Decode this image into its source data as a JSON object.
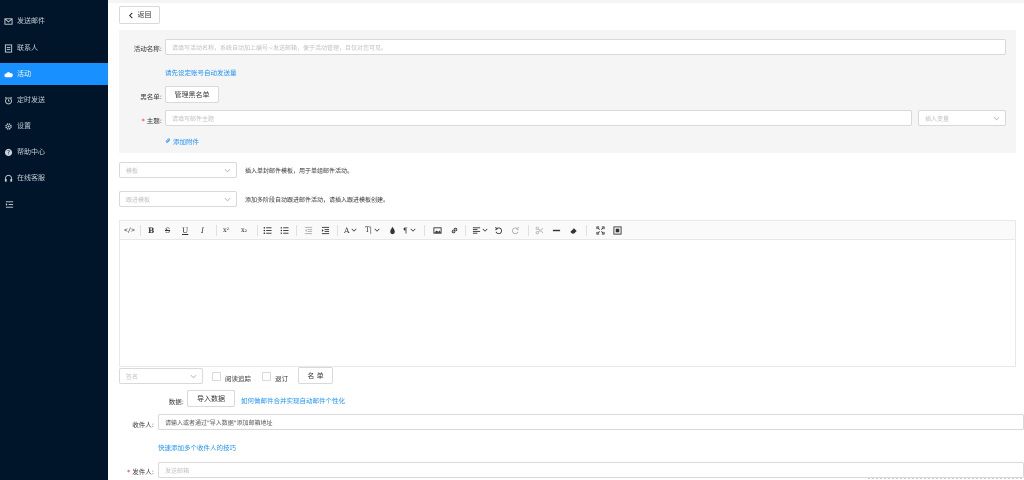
{
  "sidebar": {
    "items": [
      {
        "label": "发送邮件",
        "icon": "mail-icon"
      },
      {
        "label": "联系人",
        "icon": "contacts-icon"
      },
      {
        "label": "活动",
        "icon": "cloud-icon"
      },
      {
        "label": "定时发送",
        "icon": "alarm-clock-icon"
      },
      {
        "label": "设置",
        "icon": "gear-icon"
      },
      {
        "label": "帮助中心",
        "icon": "question-icon"
      },
      {
        "label": "在线客服",
        "icon": "headset-icon"
      }
    ],
    "active_item": "活动",
    "collapse_icon": "menu-fold-icon",
    "colors": {
      "background": "#001529",
      "active": "#1890ff"
    }
  },
  "header": {
    "back_label": "返回"
  },
  "form": {
    "activity_name_label": "活动名称:",
    "activity_name_placeholder": "请填写活动名称，系统自动加上编号~发送邮箱，便于活动管理，且仅对您可见。",
    "set_sender_link": "请先设定账号自动发送量",
    "blacklist_label": "黑名单:",
    "blacklist_button": "管理黑名单",
    "subject_required": "*",
    "subject_label": "主题:",
    "subject_placeholder": "请填写邮件主题",
    "insert_variable_placeholder": "插入变量",
    "add_attachment_link": "添加附件"
  },
  "templates": {
    "template_placeholder": "模板",
    "template_hint": "插入单封邮件模板，用于单组邮件活动。",
    "followup_placeholder": "跟进模板",
    "followup_hint": "添加多阶段自动跟进邮件活动，请插入跟进模板创建。"
  },
  "editor": {
    "toolbar": [
      "code-icon",
      "bold-icon",
      "strikethrough-icon",
      "underline-icon",
      "italic-icon",
      "superscript-icon",
      "subscript-icon",
      "unordered-list-icon",
      "ordered-list-icon",
      "outdent-icon",
      "indent-icon",
      "font-color-icon",
      "font-size-icon",
      "fill-color-icon",
      "paragraph-icon",
      "image-icon",
      "link-icon",
      "align-icon",
      "undo-icon",
      "redo-icon",
      "cut-icon",
      "horizontal-rule-icon",
      "eraser-icon",
      "fullscreen-icon",
      "source-icon"
    ],
    "toolbar_text": {
      "code": "</>",
      "bold": "B",
      "strike": "S",
      "underline": "U",
      "italic": "I",
      "sup": "x²",
      "sub": "x₂",
      "font_color": "A",
      "font_size": "T|",
      "paragraph": "¶"
    }
  },
  "options": {
    "signature_placeholder": "签名",
    "read_tracking_label": "阅读追踪",
    "tracking_label": "退订",
    "list_button": "名 单"
  },
  "data_section": {
    "data_label": "数据:",
    "import_button": "导入数据",
    "merge_link": "如何做邮件合并实现自动邮件个性化",
    "recipient_label": "收件人:",
    "recipient_placeholder": "请输入或者通过\"导入数据\"添加邮箱地址",
    "quick_add_link": "快速添加多个收件人的技巧",
    "sender_required": "*",
    "sender_label": "发件人:",
    "sender_placeholder": "发送邮箱"
  }
}
